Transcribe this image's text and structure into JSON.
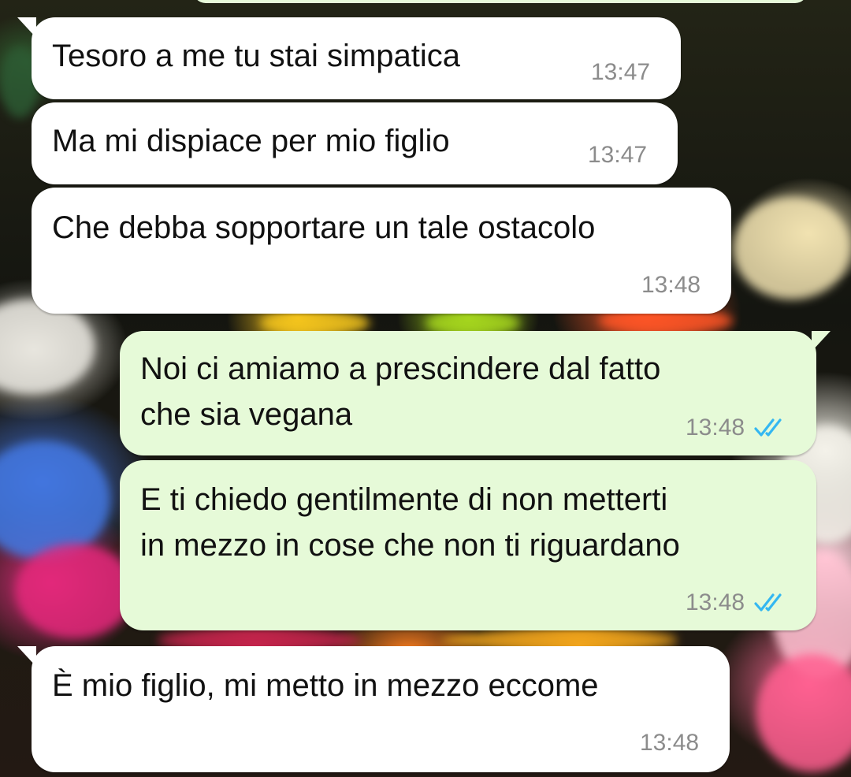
{
  "conversation": {
    "messages": [
      {
        "direction": "incoming",
        "text": "Tesoro a me tu stai simpatica",
        "time": "13:47"
      },
      {
        "direction": "incoming",
        "text": "Ma mi dispiace per mio figlio",
        "time": "13:47"
      },
      {
        "direction": "incoming",
        "text": "Che debba sopportare un tale ostacolo",
        "time": "13:48"
      },
      {
        "direction": "outgoing",
        "lines": [
          "Noi ci amiamo a prescindere dal fatto",
          "che sia vegana"
        ],
        "time": "13:48",
        "status": "read"
      },
      {
        "direction": "outgoing",
        "lines": [
          "E ti chiedo gentilmente di non metterti",
          "in mezzo in cose che non ti riguardano"
        ],
        "time": "13:48",
        "status": "read"
      },
      {
        "direction": "incoming",
        "text": "È mio figlio, mi metto in mezzo eccome",
        "time": "13:48"
      }
    ]
  },
  "icons": {
    "read_receipt": "double-check-icon"
  },
  "colors": {
    "incoming_bubble": "#ffffff",
    "outgoing_bubble": "#e6fad8",
    "timestamp": "#8c8c8c",
    "read_tick": "#34b7f1"
  }
}
